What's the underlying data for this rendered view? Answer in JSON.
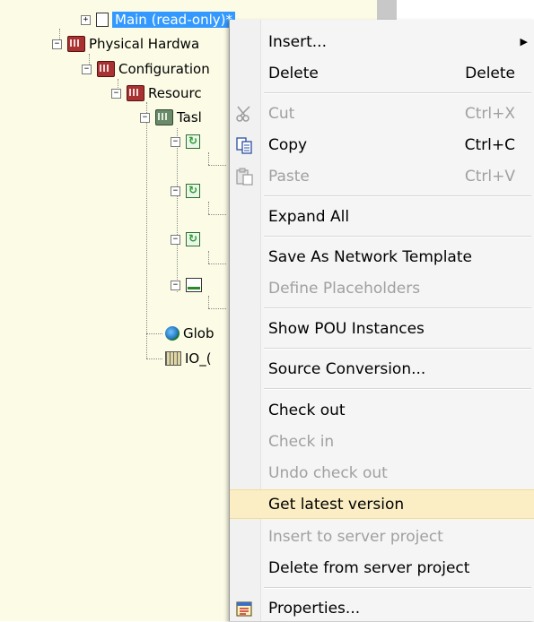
{
  "tree": {
    "items": [
      {
        "label": "Main (read-only)*",
        "selected": true
      },
      {
        "label": "Physical Hardwa"
      },
      {
        "label": "Configuration"
      },
      {
        "label": "Resourc"
      },
      {
        "label": "Tasl"
      },
      {
        "label": "Glob"
      },
      {
        "label": "IO_("
      }
    ]
  },
  "menu": {
    "items": [
      {
        "label": "Insert...",
        "shortcut": "",
        "submenu": true,
        "enabled": true,
        "icon": ""
      },
      {
        "label": "Delete",
        "shortcut": "Delete",
        "enabled": true,
        "icon": ""
      },
      {
        "label": "Cut",
        "shortcut": "Ctrl+X",
        "enabled": false,
        "icon": "scissors-icon"
      },
      {
        "label": "Copy",
        "shortcut": "Ctrl+C",
        "enabled": true,
        "icon": "copy-icon"
      },
      {
        "label": "Paste",
        "shortcut": "Ctrl+V",
        "enabled": false,
        "icon": "paste-icon"
      },
      {
        "label": "Expand All",
        "shortcut": "",
        "enabled": true,
        "icon": ""
      },
      {
        "label": "Save As Network Template",
        "shortcut": "",
        "enabled": true,
        "icon": ""
      },
      {
        "label": "Define Placeholders",
        "shortcut": "",
        "enabled": false,
        "icon": ""
      },
      {
        "label": "Show POU Instances",
        "shortcut": "",
        "enabled": true,
        "icon": ""
      },
      {
        "label": "Source Conversion...",
        "shortcut": "",
        "enabled": true,
        "icon": ""
      },
      {
        "label": "Check out",
        "shortcut": "",
        "enabled": true,
        "icon": ""
      },
      {
        "label": "Check in",
        "shortcut": "",
        "enabled": false,
        "icon": ""
      },
      {
        "label": "Undo check out",
        "shortcut": "",
        "enabled": false,
        "icon": ""
      },
      {
        "label": "Get latest version",
        "shortcut": "",
        "enabled": true,
        "highlighted": true,
        "icon": ""
      },
      {
        "label": "Insert to server project",
        "shortcut": "",
        "enabled": false,
        "icon": ""
      },
      {
        "label": "Delete from server project",
        "shortcut": "",
        "enabled": true,
        "icon": ""
      },
      {
        "label": "Properties...",
        "shortcut": "",
        "enabled": true,
        "icon": "properties-icon"
      }
    ]
  },
  "colors": {
    "selection": "#3399ff",
    "highlight": "#fbeec4",
    "disabled_text": "#a0a0a0",
    "tree_background": "#fbfbe6"
  }
}
